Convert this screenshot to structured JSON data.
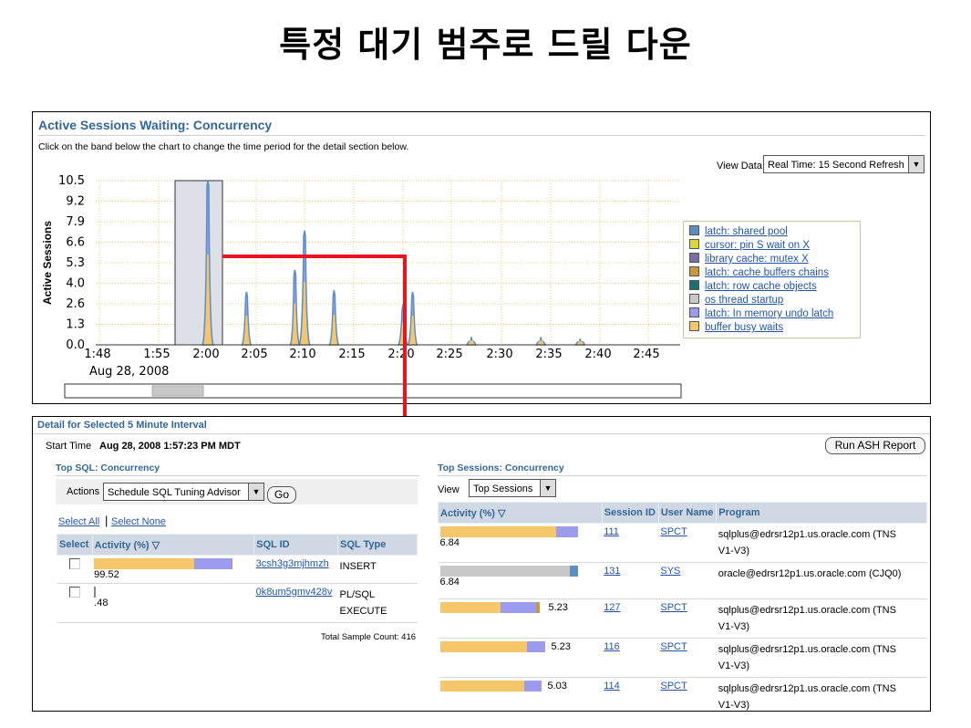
{
  "slide_title": "특정 대기 범주로 드릴 다운",
  "top": {
    "title": "Active Sessions Waiting: Concurrency",
    "instruction": "Click on the band below the chart to change the time period for the detail section below.",
    "view_data_label": "View Data",
    "view_data_value": "Real Time: 15 Second Refresh",
    "ylabel": "Active Sessions",
    "date_label": "Aug 28, 2008"
  },
  "chart_data": {
    "type": "area",
    "ylabel": "Active Sessions",
    "ylim": [
      0,
      10.5
    ],
    "yticks": [
      "10.5",
      "9.2",
      "7.9",
      "6.6",
      "5.3",
      "4.0",
      "2.6",
      "1.3",
      "0.0"
    ],
    "xticks": [
      "1:48",
      "1:55",
      "2:00",
      "2:05",
      "2:10",
      "2:15",
      "2:20",
      "2:25",
      "2:30",
      "2:35",
      "2:40",
      "2:45"
    ],
    "x_date": "Aug 28, 2008",
    "grid": true,
    "legend_position": "right",
    "selected_interval": [
      "1:57",
      "2:02"
    ],
    "series_peaks": [
      {
        "x": "2:00",
        "y": 10.5
      },
      {
        "x": "2:04",
        "y": 3.4
      },
      {
        "x": "2:09",
        "y": 4.8
      },
      {
        "x": "2:10",
        "y": 7.3
      },
      {
        "x": "2:13",
        "y": 3.5
      },
      {
        "x": "2:20",
        "y": 2.6
      },
      {
        "x": "2:21",
        "y": 3.4
      },
      {
        "x": "2:27",
        "y": 0.5
      },
      {
        "x": "2:34",
        "y": 0.5
      },
      {
        "x": "2:38",
        "y": 0.4
      }
    ],
    "legend": [
      {
        "label": "latch: shared pool",
        "color": "#5b8fc2"
      },
      {
        "label": "cursor: pin S wait on X",
        "color": "#d9d93a"
      },
      {
        "label": "library cache: mutex X",
        "color": "#7f6aa8"
      },
      {
        "label": "latch: cache buffers chains",
        "color": "#c89a3c"
      },
      {
        "label": "latch: row cache objects",
        "color": "#1e6e6e"
      },
      {
        "label": "os thread startup",
        "color": "#c8c8c8"
      },
      {
        "label": "latch: In memory undo latch",
        "color": "#9b9bf0"
      },
      {
        "label": "buffer busy waits",
        "color": "#f6c66a"
      }
    ]
  },
  "detail": {
    "title": "Detail for Selected 5 Minute Interval",
    "start_time_label": "Start Time",
    "start_time_value": "Aug 28, 2008 1:57:23 PM MDT",
    "run_ash_button": "Run ASH Report"
  },
  "top_sql": {
    "title": "Top SQL: Concurrency",
    "actions_label": "Actions",
    "actions_value": "Schedule SQL Tuning Advisor",
    "go_button": "Go",
    "select_all": "Select All",
    "select_none": "Select None",
    "columns": [
      "Select",
      "Activity (%)",
      "SQL ID",
      "SQL Type"
    ],
    "rows": [
      {
        "activity": "99.52",
        "sql_id": "3csh3g3mjhmzh",
        "sql_type_1": "INSERT",
        "sql_type_2": "",
        "bars": [
          {
            "pct": 72,
            "color": "#f6c66a"
          },
          {
            "pct": 27,
            "color": "#9b9bf0"
          },
          {
            "pct": 1,
            "color": "#c89a3c"
          }
        ]
      },
      {
        "activity": ".48",
        "sql_id": "0k8um5gmv428v",
        "sql_type_1": "PL/SQL",
        "sql_type_2": "EXECUTE",
        "bars": [
          {
            "pct": 1,
            "color": "#888888"
          }
        ]
      }
    ],
    "total_label": "Total Sample Count: 416"
  },
  "top_sessions": {
    "title": "Top Sessions: Concurrency",
    "view_label": "View",
    "view_value": "Top Sessions",
    "columns": [
      "Activity (%)",
      "Session ID",
      "User Name",
      "Program"
    ],
    "rows": [
      {
        "activity": "6.84",
        "session_id": "111",
        "user": "SPCT",
        "program_1": "sqlplus@edrsr12p1.us.oracle.com (TNS",
        "program_2": "V1-V3)",
        "bars": [
          {
            "pct": 84,
            "color": "#f6c66a"
          },
          {
            "pct": 16,
            "color": "#9b9bf0"
          }
        ]
      },
      {
        "activity": "6.84",
        "session_id": "131",
        "user": "SYS",
        "program_1": "oracle@edrsr12p1.us.oracle.com (CJQ0)",
        "program_2": "",
        "bars": [
          {
            "pct": 94,
            "color": "#c8c8c8"
          },
          {
            "pct": 6,
            "color": "#5b8fc2"
          }
        ]
      },
      {
        "activity": "5.23",
        "session_id": "127",
        "user": "SPCT",
        "program_1": "sqlplus@edrsr12p1.us.oracle.com (TNS",
        "program_2": "V1-V3)",
        "bars": [
          {
            "pct": 59,
            "color": "#f6c66a"
          },
          {
            "pct": 34,
            "color": "#9b9bf0"
          },
          {
            "pct": 4,
            "color": "#c89a3c"
          }
        ]
      },
      {
        "activity": "5.23",
        "session_id": "116",
        "user": "SPCT",
        "program_1": "sqlplus@edrsr12p1.us.oracle.com (TNS",
        "program_2": "V1-V3)",
        "bars": [
          {
            "pct": 82,
            "color": "#f6c66a"
          },
          {
            "pct": 18,
            "color": "#9b9bf0"
          }
        ]
      },
      {
        "activity": "5.03",
        "session_id": "114",
        "user": "SPCT",
        "program_1": "sqlplus@edrsr12p1.us.oracle.com (TNS",
        "program_2": "V1-V3)",
        "bars": [
          {
            "pct": 83,
            "color": "#f6c66a"
          },
          {
            "pct": 17,
            "color": "#9b9bf0"
          }
        ]
      }
    ]
  }
}
